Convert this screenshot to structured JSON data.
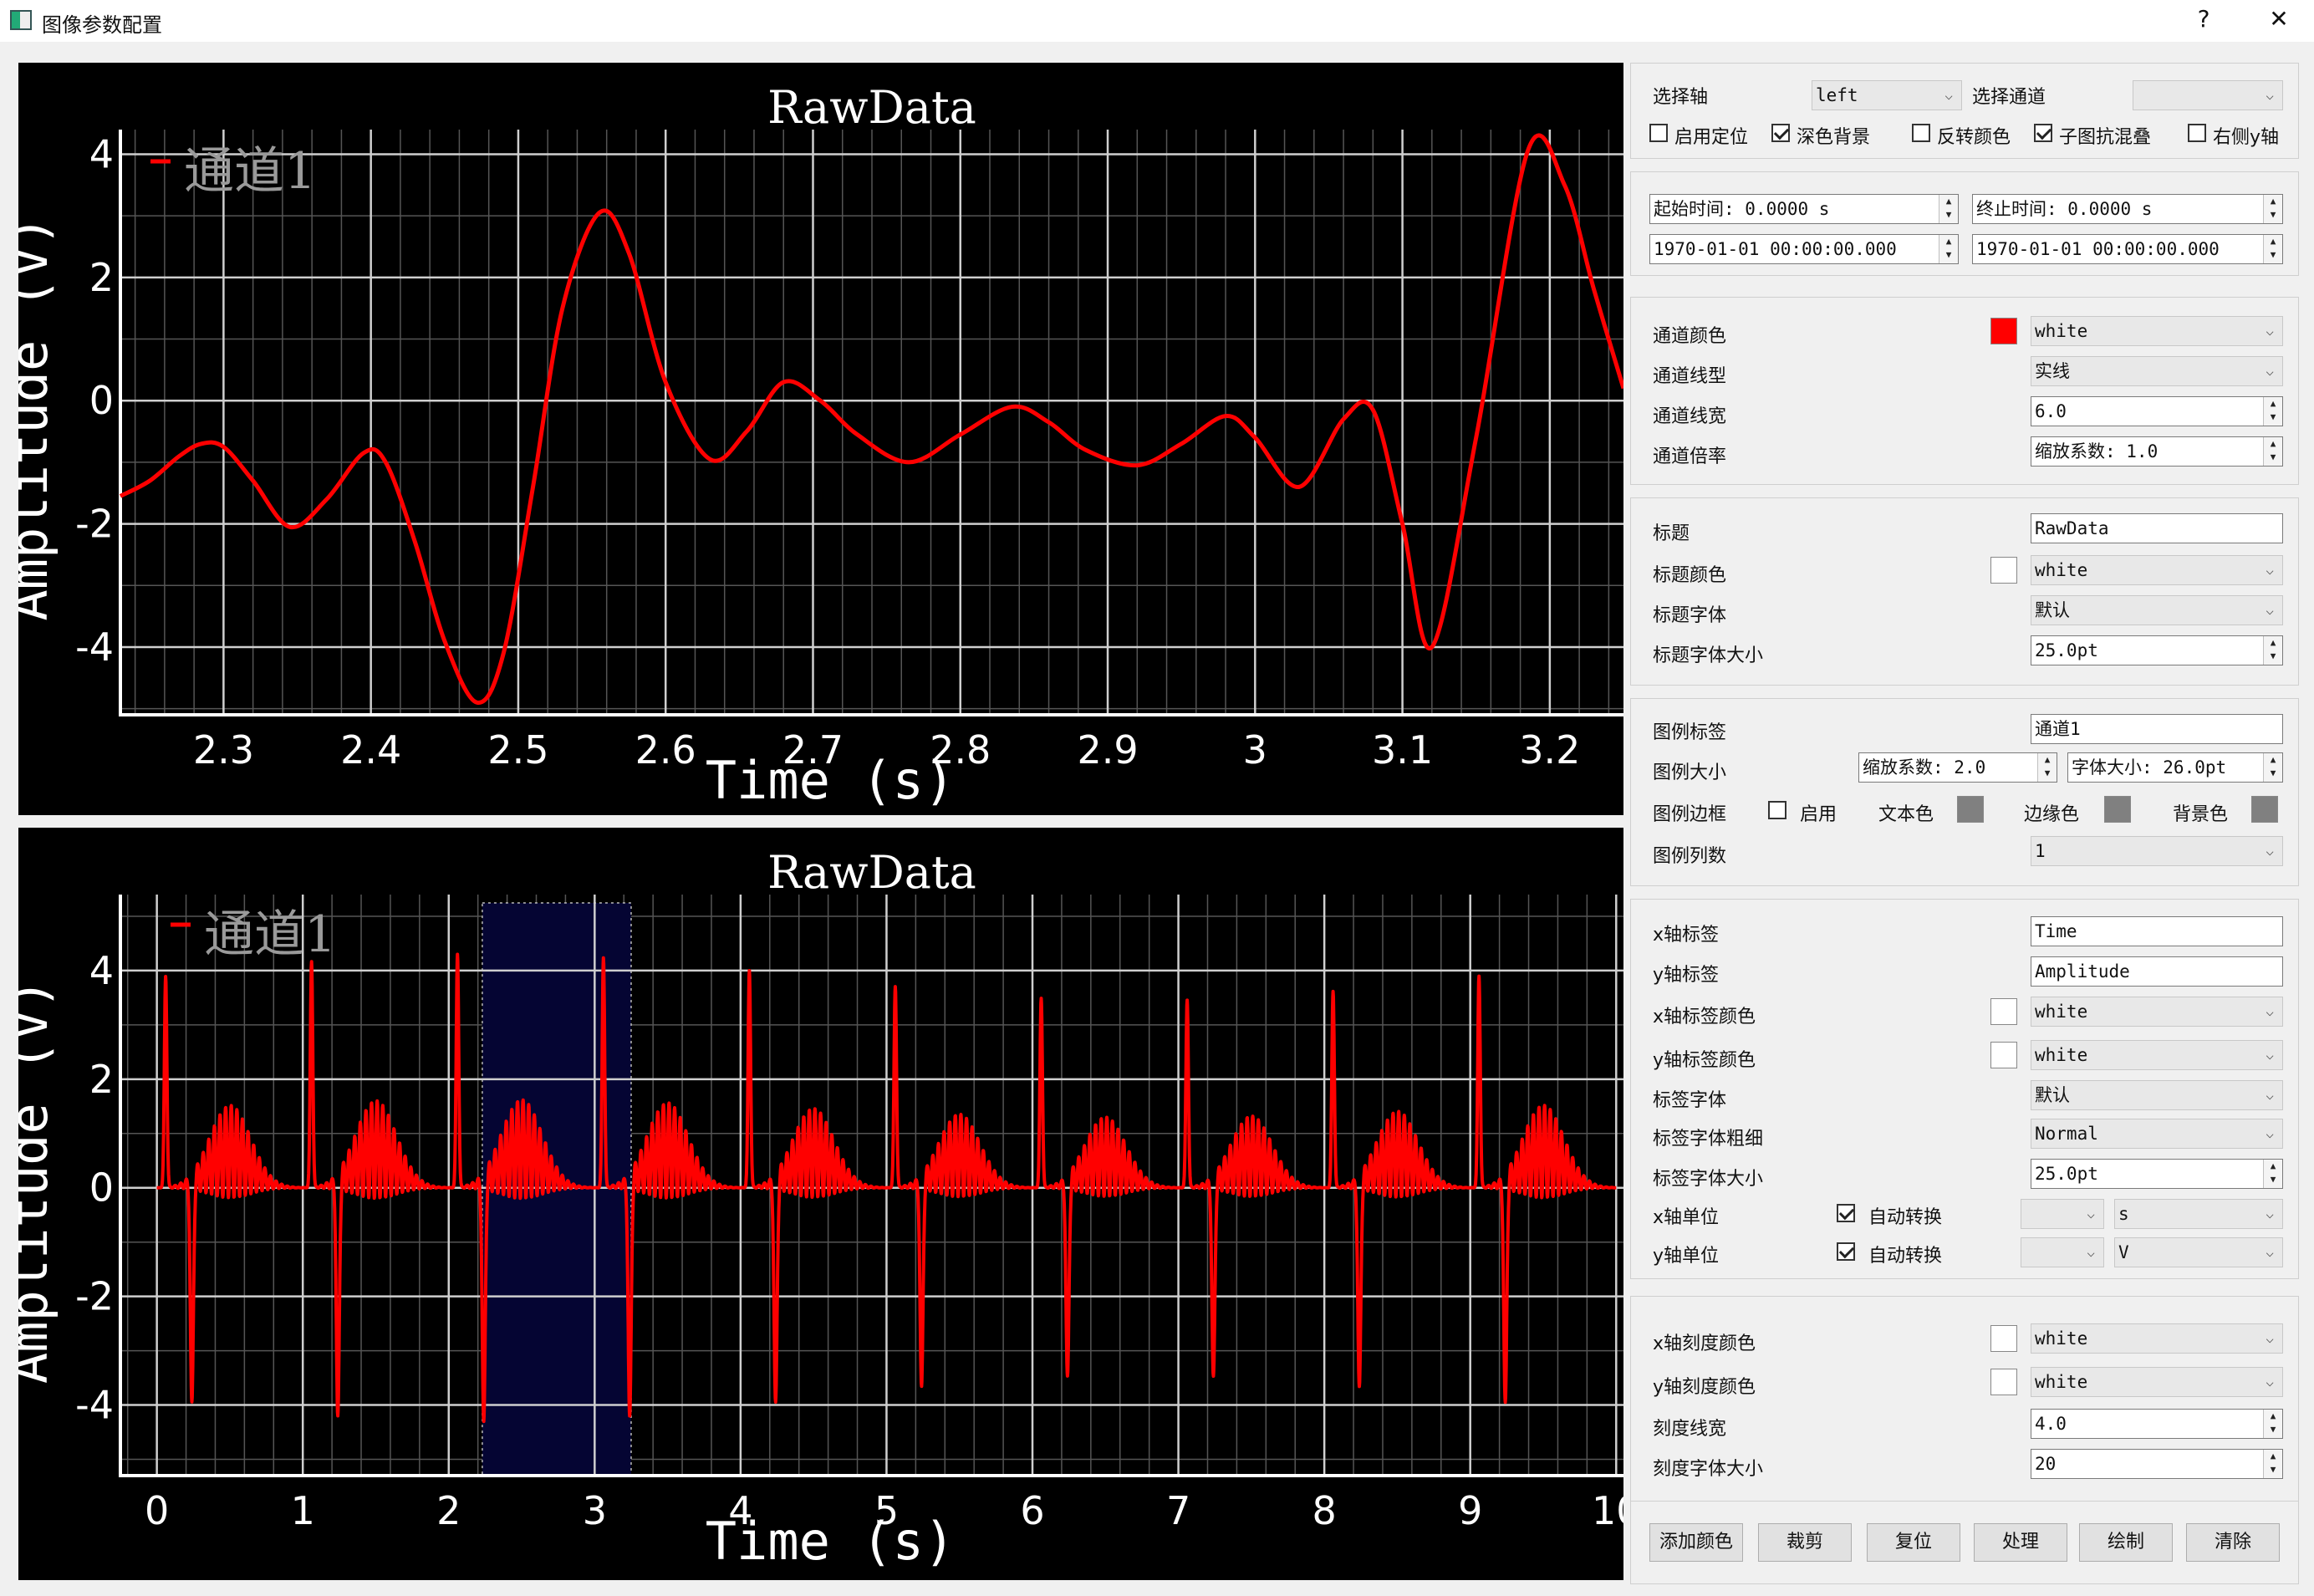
{
  "window": {
    "title": "图像参数配置",
    "help": "?",
    "close": "✕",
    "accent": "#ffffff"
  },
  "plot_top": {
    "chart_data": {
      "type": "line",
      "title": "RawData",
      "xlabel": "Time (s)",
      "ylabel": "Amplitude (V)",
      "legend": [
        "通道1"
      ],
      "xlim": [
        2.23,
        3.25
      ],
      "ylim": [
        -5.1,
        4.4
      ],
      "xticks": [
        "2.3",
        "2.4",
        "2.5",
        "2.6",
        "2.7",
        "2.8",
        "2.9",
        "3",
        "3.1",
        "3.2"
      ],
      "yticks": [
        "4",
        "2",
        "0",
        "-2",
        "-4"
      ],
      "series": [
        {
          "name": "通道1",
          "color": "#ff0000",
          "x": [
            2.23,
            2.25,
            2.27,
            2.285,
            2.3,
            2.32,
            2.345,
            2.37,
            2.395,
            2.41,
            2.43,
            2.45,
            2.472,
            2.49,
            2.51,
            2.53,
            2.555,
            2.575,
            2.6,
            2.63,
            2.655,
            2.68,
            2.705,
            2.73,
            2.765,
            2.8,
            2.835,
            2.86,
            2.885,
            2.92,
            2.95,
            2.98,
            3.0,
            3.03,
            3.06,
            3.08,
            3.1,
            3.12,
            3.15,
            3.185,
            3.21,
            3.23,
            3.25
          ],
          "y": [
            -1.55,
            -1.3,
            -0.9,
            -0.7,
            -0.75,
            -1.3,
            -2.05,
            -1.6,
            -0.85,
            -1.0,
            -2.3,
            -3.9,
            -4.9,
            -4.1,
            -1.4,
            1.5,
            3.05,
            2.4,
            0.3,
            -0.95,
            -0.5,
            0.3,
            0.0,
            -0.55,
            -1.0,
            -0.55,
            -0.1,
            -0.35,
            -0.8,
            -1.05,
            -0.7,
            -0.25,
            -0.6,
            -1.4,
            -0.3,
            -0.15,
            -2.0,
            -4.0,
            -0.6,
            4.05,
            3.5,
            1.8,
            0.2
          ]
        }
      ]
    }
  },
  "plot_bottom": {
    "chart_data": {
      "type": "line",
      "title": "RawData",
      "xlabel": "Time (s)",
      "ylabel": "Amplitude (V)",
      "legend": [
        "通道1"
      ],
      "xlim": [
        -0.25,
        10.05
      ],
      "ylim": [
        -5.3,
        5.4
      ],
      "xticks": [
        "0",
        "1",
        "2",
        "3",
        "4",
        "5",
        "6",
        "7",
        "8",
        "9",
        "10"
      ],
      "yticks": [
        "4",
        "2",
        "0",
        "-2",
        "-4"
      ],
      "selection": [
        2.23,
        3.25
      ],
      "series": [
        {
          "name": "通道1",
          "color": "#ff0000"
        }
      ]
    }
  },
  "axis_group": {
    "select_axis_label": "选择轴",
    "select_axis_value": "left",
    "select_channel_label": "选择通道",
    "select_channel_value": "",
    "checks": [
      {
        "label": "启用定位",
        "checked": false
      },
      {
        "label": "深色背景",
        "checked": true
      },
      {
        "label": "反转颜色",
        "checked": false
      },
      {
        "label": "子图抗混叠",
        "checked": true
      },
      {
        "label": "右侧y轴",
        "checked": false
      }
    ]
  },
  "time_group": {
    "start_time": "起始时间: 0.0000 s",
    "end_time": "终止时间: 0.0000 s",
    "start_datetime": "1970-01-01 00:00:00.000",
    "end_datetime": "1970-01-01 00:00:00.000"
  },
  "channel_group": {
    "color_label": "通道颜色",
    "color_value": "white",
    "color_swatch": "#ff0000",
    "linestyle_label": "通道线型",
    "linestyle_value": "实线",
    "linewidth_label": "通道线宽",
    "linewidth_value": "6.0",
    "scale_label": "通道倍率",
    "scale_value": "缩放系数: 1.0"
  },
  "title_group": {
    "title_label": "标题",
    "title_value": "RawData",
    "color_label": "标题颜色",
    "color_value": "white",
    "font_label": "标题字体",
    "font_value": "默认",
    "size_label": "标题字体大小",
    "size_value": "25.0pt"
  },
  "legend_group": {
    "label_label": "图例标签",
    "label_value": "通道1",
    "size_label": "图例大小",
    "scale_value": "缩放系数: 2.0",
    "fontsize_value": "字体大小: 26.0pt",
    "border_label": "图例边框",
    "enable_label": "启用",
    "textcolor_label": "文本色",
    "edgecolor_label": "边缘色",
    "bgcolor_label": "背景色",
    "swatch_color": "#808080",
    "columns_label": "图例列数",
    "columns_value": "1"
  },
  "label_group": {
    "xlabel_label": "x轴标签",
    "xlabel_value": "Time",
    "ylabel_label": "y轴标签",
    "ylabel_value": "Amplitude",
    "xcolor_label": "x轴标签颜色",
    "xcolor_value": "white",
    "ycolor_label": "y轴标签颜色",
    "ycolor_value": "white",
    "font_label": "标签字体",
    "font_value": "默认",
    "weight_label": "标签字体粗细",
    "weight_value": "Normal",
    "size_label": "标签字体大小",
    "size_value": "25.0pt",
    "xunit_label": "x轴单位",
    "yunit_label": "y轴单位",
    "auto_label": "自动转换",
    "xunit_value": "s",
    "yunit_value": "V"
  },
  "tick_group": {
    "xcolor_label": "x轴刻度颜色",
    "xcolor_value": "white",
    "ycolor_label": "y轴刻度颜色",
    "ycolor_value": "white",
    "width_label": "刻度线宽",
    "width_value": "4.0",
    "size_label": "刻度字体大小",
    "size_value": "20"
  },
  "buttons": [
    "添加颜色",
    "裁剪",
    "复位",
    "处理",
    "绘制",
    "清除"
  ]
}
